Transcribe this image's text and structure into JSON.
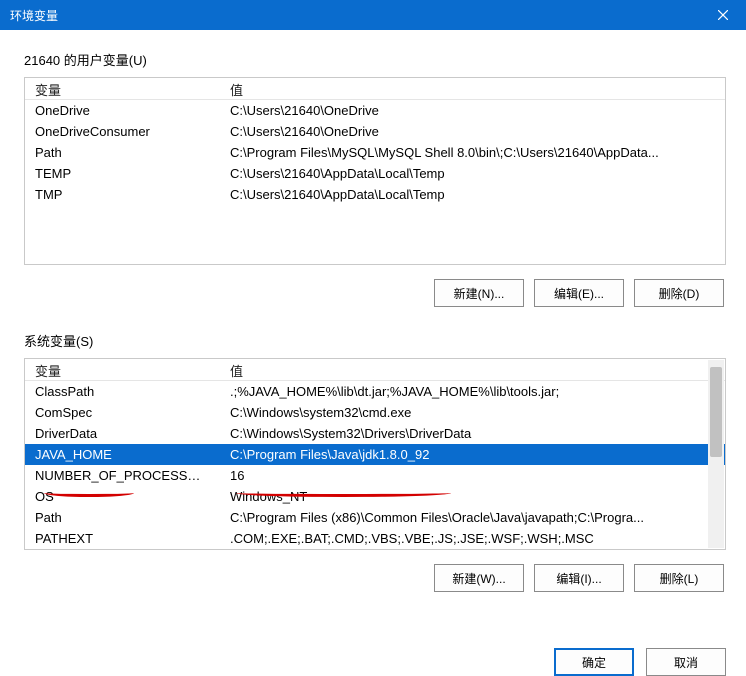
{
  "title": "环境变量",
  "userSection": {
    "label": "21640 的用户变量(U)",
    "headers": {
      "var": "变量",
      "val": "值"
    },
    "rows": [
      {
        "var": "OneDrive",
        "val": "C:\\Users\\21640\\OneDrive"
      },
      {
        "var": "OneDriveConsumer",
        "val": "C:\\Users\\21640\\OneDrive"
      },
      {
        "var": "Path",
        "val": "C:\\Program Files\\MySQL\\MySQL Shell 8.0\\bin\\;C:\\Users\\21640\\AppData..."
      },
      {
        "var": "TEMP",
        "val": "C:\\Users\\21640\\AppData\\Local\\Temp"
      },
      {
        "var": "TMP",
        "val": "C:\\Users\\21640\\AppData\\Local\\Temp"
      }
    ],
    "buttons": {
      "new": "新建(N)...",
      "edit": "编辑(E)...",
      "delete": "删除(D)"
    }
  },
  "sysSection": {
    "label": "系统变量(S)",
    "headers": {
      "var": "变量",
      "val": "值"
    },
    "rows": [
      {
        "var": "ClassPath",
        "val": ".;%JAVA_HOME%\\lib\\dt.jar;%JAVA_HOME%\\lib\\tools.jar;"
      },
      {
        "var": "ComSpec",
        "val": "C:\\Windows\\system32\\cmd.exe"
      },
      {
        "var": "DriverData",
        "val": "C:\\Windows\\System32\\Drivers\\DriverData"
      },
      {
        "var": "JAVA_HOME",
        "val": "C:\\Program Files\\Java\\jdk1.8.0_92",
        "selected": true
      },
      {
        "var": "NUMBER_OF_PROCESSORS",
        "val": "16"
      },
      {
        "var": "OS",
        "val": "Windows_NT"
      },
      {
        "var": "Path",
        "val": "C:\\Program Files (x86)\\Common Files\\Oracle\\Java\\javapath;C:\\Progra..."
      },
      {
        "var": "PATHEXT",
        "val": ".COM;.EXE;.BAT;.CMD;.VBS;.VBE;.JS;.JSE;.WSF;.WSH;.MSC"
      }
    ],
    "buttons": {
      "new": "新建(W)...",
      "edit": "编辑(I)...",
      "delete": "删除(L)"
    }
  },
  "dialogButtons": {
    "ok": "确定",
    "cancel": "取消"
  }
}
